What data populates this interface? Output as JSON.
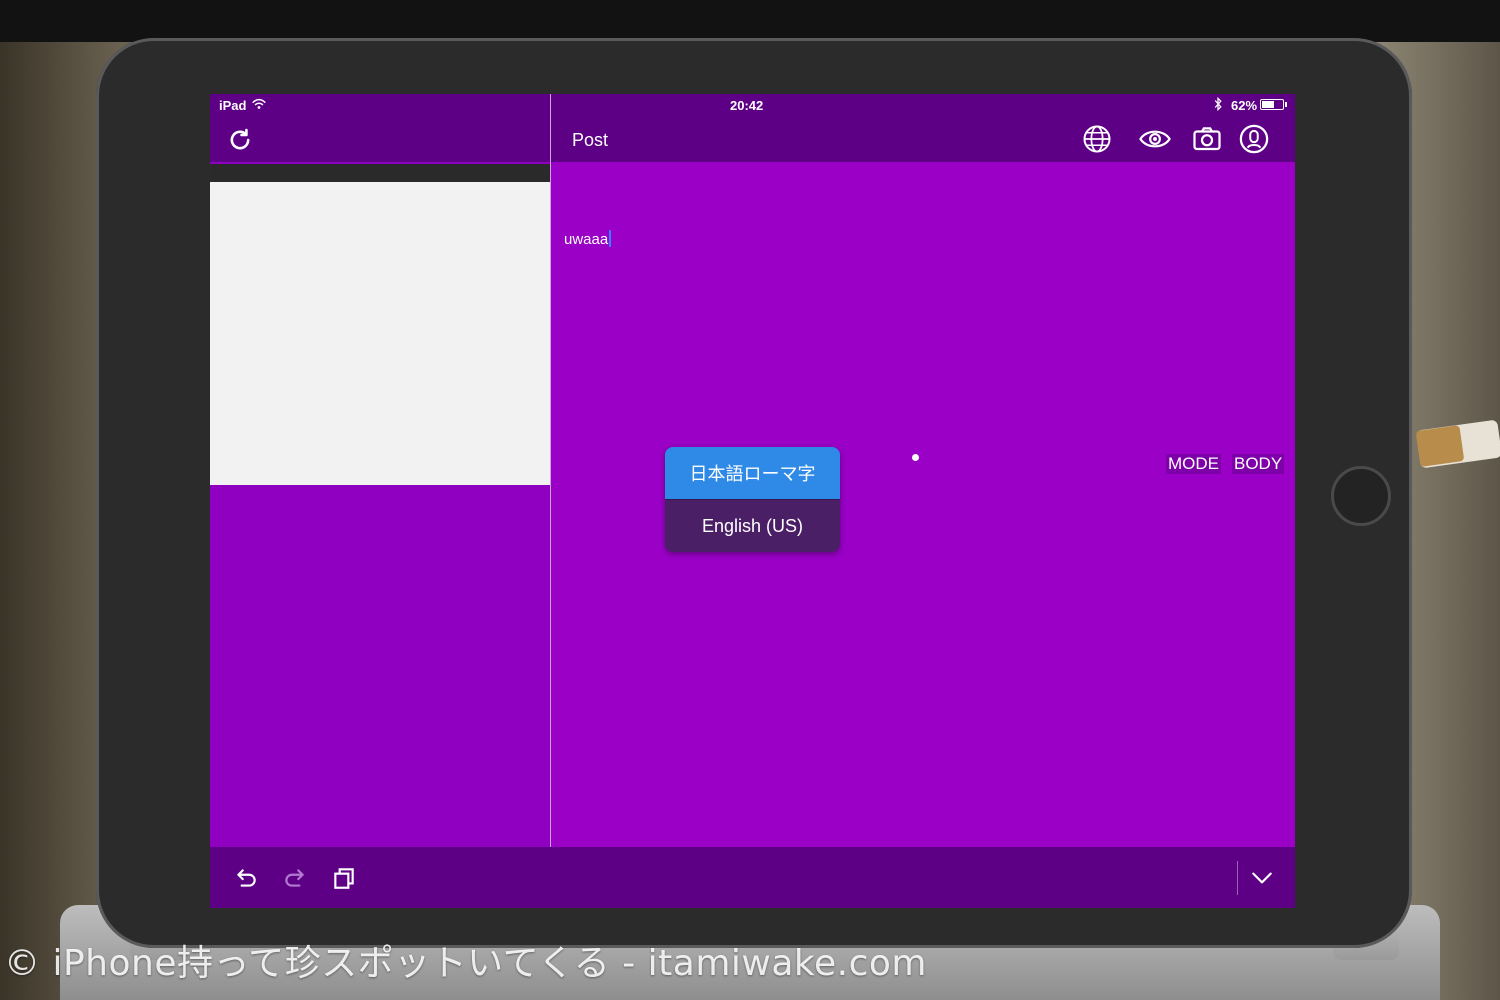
{
  "status_bar": {
    "carrier": "iPad",
    "time": "20:42",
    "battery": "62%",
    "battery_level": 0.62,
    "icons": [
      "wifi-icon",
      "bluetooth-icon",
      "battery-icon"
    ]
  },
  "left_pane": {
    "refresh_icon": "refresh-icon"
  },
  "header": {
    "title": "Post",
    "icons": [
      "globe-icon",
      "eye-icon",
      "camera-icon",
      "account-icon"
    ]
  },
  "editor": {
    "text": "uwaaa",
    "mode_label": "MODE",
    "body_label": "BODY"
  },
  "language_popup": {
    "options": [
      {
        "label": "日本語ローマ字",
        "selected": true
      },
      {
        "label": "English (US)",
        "selected": false
      }
    ]
  },
  "toolbar": {
    "icons": [
      "undo-icon",
      "redo-icon",
      "copy-icon",
      "chevron-down-icon"
    ]
  },
  "watermark": "© iPhone持って珍スポットいてくる - itamiwake.com",
  "colors": {
    "header": "#5e0086",
    "editor": "#9a00c6",
    "selected": "#2e8ae6"
  }
}
